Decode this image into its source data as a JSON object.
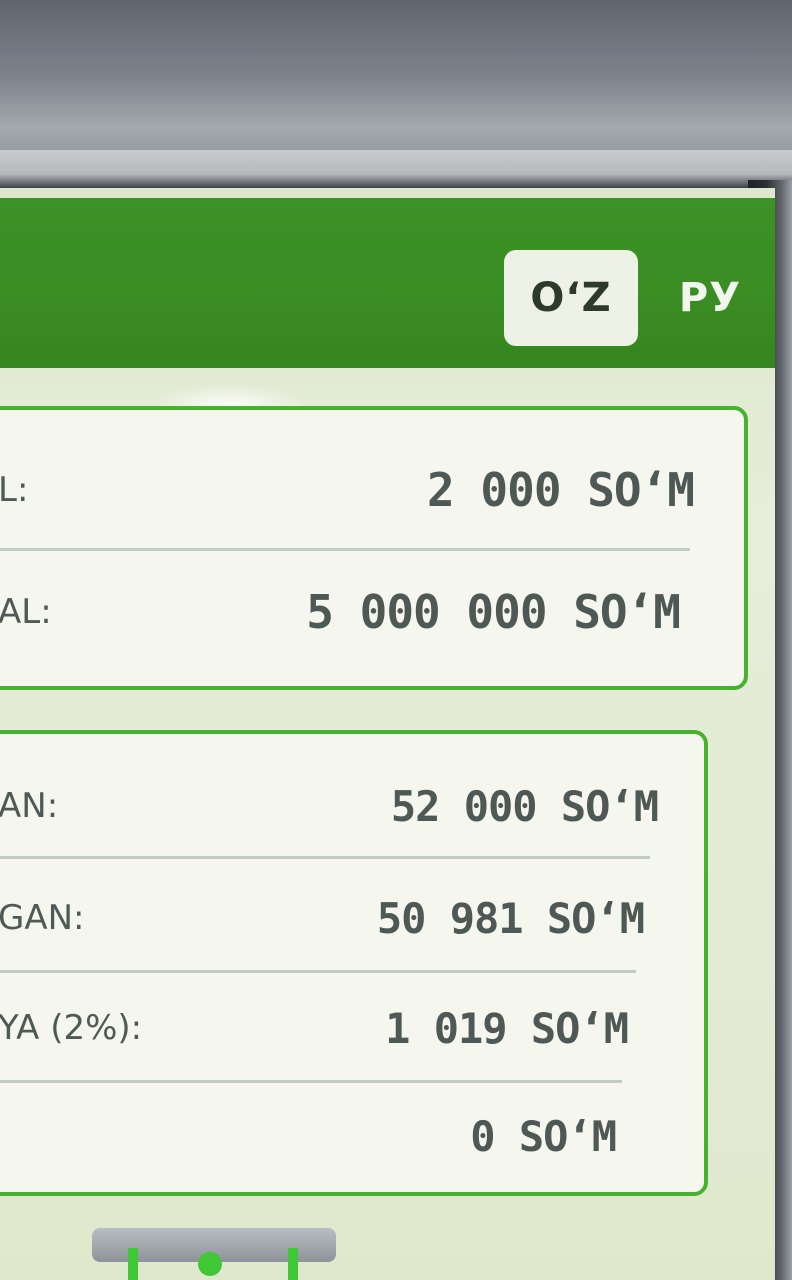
{
  "header": {
    "languages": [
      {
        "label": "O‘Z",
        "active": true
      },
      {
        "label": "РУ",
        "active": false
      }
    ],
    "background_color": "#3a8d22"
  },
  "limits_card": {
    "rows": [
      {
        "label": "L:",
        "value": "2 000 SO‘M"
      },
      {
        "label": "AL:",
        "value": "5 000 000 SO‘M"
      }
    ]
  },
  "payment_card": {
    "rows": [
      {
        "label": "AN:",
        "value": "52 000 SO‘M"
      },
      {
        "label": "GAN:",
        "value": "50 981 SO‘M"
      },
      {
        "label": "YA (2%):",
        "value": "1 019 SO‘M"
      },
      {
        "label": "",
        "value": "0 SO‘M"
      }
    ]
  },
  "colors": {
    "accent_green": "#46b32f",
    "card_background": "#f5f6ee",
    "text": "#4e5955"
  },
  "icons": {
    "bill_slot": "bill-acceptor-slot-icon"
  }
}
